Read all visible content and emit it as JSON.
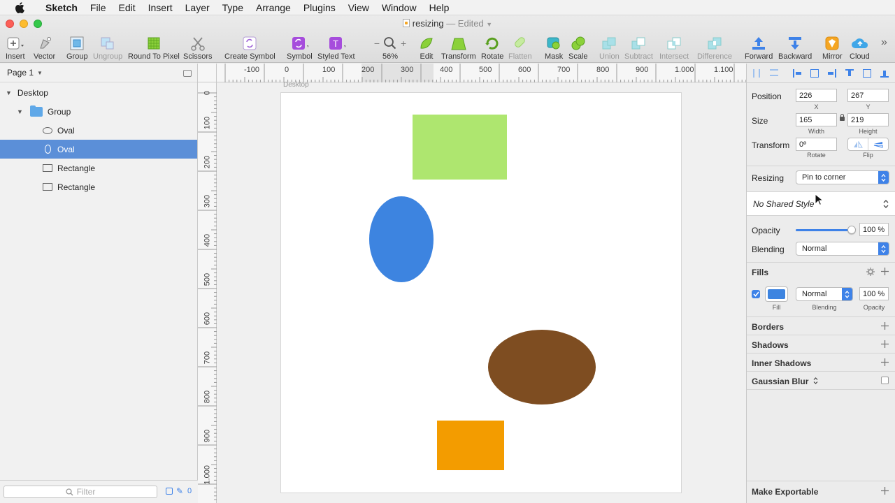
{
  "menubar": {
    "app": "Sketch",
    "items": [
      "File",
      "Edit",
      "Insert",
      "Layer",
      "Type",
      "Arrange",
      "Plugins",
      "View",
      "Window",
      "Help"
    ]
  },
  "window": {
    "title": "resizing",
    "edited": "— Edited"
  },
  "toolbar": {
    "insert": "Insert",
    "vector": "Vector",
    "group": "Group",
    "ungroup": "Ungroup",
    "round": "Round To Pixel",
    "scissors": "Scissors",
    "create_symbol": "Create Symbol",
    "symbol": "Symbol",
    "styled_text": "Styled Text",
    "zoom": "56%",
    "edit": "Edit",
    "transform": "Transform",
    "rotate": "Rotate",
    "flatten": "Flatten",
    "mask": "Mask",
    "scale": "Scale",
    "union": "Union",
    "subtract": "Subtract",
    "intersect": "Intersect",
    "difference": "Difference",
    "forward": "Forward",
    "backward": "Backward",
    "mirror": "Mirror",
    "cloud": "Cloud"
  },
  "layers": {
    "page": "Page 1",
    "items": [
      {
        "label": "Desktop"
      },
      {
        "label": "Group"
      },
      {
        "label": "Oval"
      },
      {
        "label": "Oval"
      },
      {
        "label": "Rectangle"
      },
      {
        "label": "Rectangle"
      }
    ],
    "filter_placeholder": "Filter",
    "filter_count": "0"
  },
  "canvas": {
    "artboard_name": "Desktop",
    "hruler_labels": [
      "-100",
      "0",
      "100",
      "200",
      "300",
      "400",
      "500",
      "600",
      "700",
      "800",
      "900",
      "1.000",
      "1.100"
    ],
    "vruler_labels": [
      "0",
      "100",
      "200",
      "300",
      "400",
      "500",
      "600",
      "700",
      "800",
      "900",
      "1.000"
    ],
    "colors": {
      "green": "#aee66f",
      "blue": "#3d84e0",
      "brown": "#7e4d21",
      "orange": "#f39c00"
    }
  },
  "inspector": {
    "position_label": "Position",
    "pos_x": "226",
    "pos_y": "267",
    "x_label": "X",
    "y_label": "Y",
    "size_label": "Size",
    "width": "165",
    "height": "219",
    "width_label": "Width",
    "height_label": "Height",
    "transform_label": "Transform",
    "rotate": "0º",
    "rotate_label": "Rotate",
    "flip_label": "Flip",
    "resizing_label": "Resizing",
    "resizing": "Pin to corner",
    "shared_style": "No Shared Style",
    "opacity_label": "Opacity",
    "opacity": "100 %",
    "opacity_level": 1.0,
    "blending_label": "Blending",
    "blending": "Normal",
    "fills_label": "Fills",
    "fill_label": "Fill",
    "fill_blend": "Normal",
    "fill_blend_label": "Blending",
    "fill_opacity": "100 %",
    "fill_opacity_label": "Opacity",
    "fill_color": "#3d84e0",
    "borders": "Borders",
    "shadows": "Shadows",
    "inner_shadows": "Inner Shadows",
    "gaussian_blur": "Gaussian Blur",
    "make_exportable": "Make Exportable"
  }
}
